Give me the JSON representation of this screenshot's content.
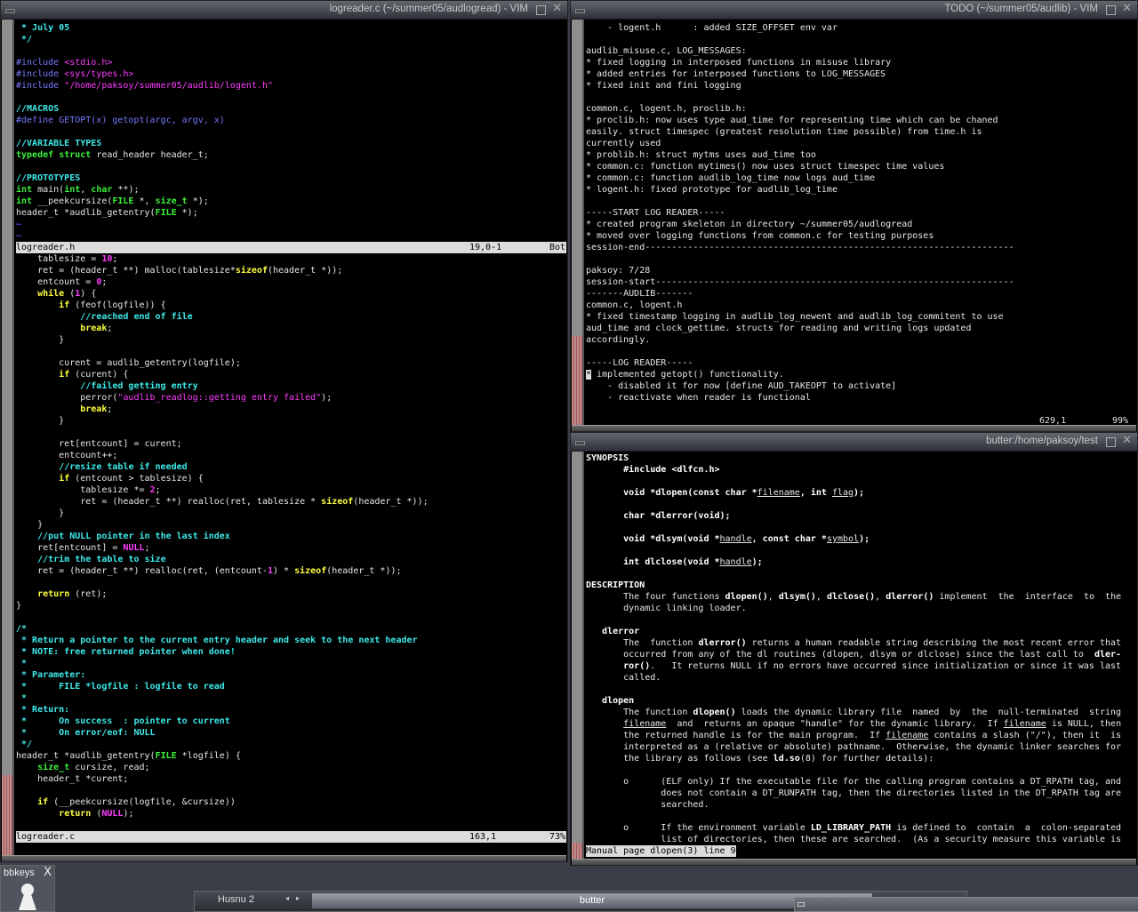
{
  "left_window": {
    "title": "logreader.c (~/summer05/audlogread) - VIM",
    "top_buffer": {
      "lines": [
        [
          [
            "c",
            " * July 05"
          ]
        ],
        [
          [
            "c",
            " */"
          ]
        ],
        [],
        [
          [
            "p",
            "#include "
          ],
          [
            "s",
            "<stdio.h>"
          ]
        ],
        [
          [
            "p",
            "#include "
          ],
          [
            "s",
            "<sys/types.h>"
          ]
        ],
        [
          [
            "p",
            "#include "
          ],
          [
            "s",
            "\"/home/paksoy/summer05/audlib/logent.h\""
          ]
        ],
        [],
        [
          [
            "c",
            "//MACROS"
          ]
        ],
        [
          [
            "p",
            "#define GETOPT(x) getopt(argc, argv, x)"
          ]
        ],
        [],
        [
          [
            "c",
            "//VARIABLE TYPES"
          ]
        ],
        [
          [
            "t",
            "typedef"
          ],
          [
            "x",
            " "
          ],
          [
            "t",
            "struct"
          ],
          [
            "x",
            " read_header header_t;"
          ]
        ],
        [],
        [
          [
            "c",
            "//PROTOTYPES"
          ]
        ],
        [
          [
            "t",
            "int"
          ],
          [
            "x",
            " main("
          ],
          [
            "t",
            "int"
          ],
          [
            "x",
            ", "
          ],
          [
            "t",
            "char"
          ],
          [
            "x",
            " **);"
          ]
        ],
        [
          [
            "t",
            "int"
          ],
          [
            "x",
            " __peekcursize("
          ],
          [
            "t",
            "FILE"
          ],
          [
            "x",
            " *, "
          ],
          [
            "t",
            "size_t"
          ],
          [
            "x",
            " *);"
          ]
        ],
        [
          [
            "x",
            "header_t *audlib_getentry("
          ],
          [
            "t",
            "FILE"
          ],
          [
            "x",
            " *);"
          ]
        ],
        [
          [
            "tl",
            "~"
          ]
        ],
        [
          [
            "tl",
            "~"
          ]
        ]
      ],
      "status": {
        "file": "logreader.h",
        "position": "19,0-1",
        "scroll": "Bot"
      }
    },
    "bottom_buffer": {
      "lines": [
        [
          [
            "x",
            "    tablesize = "
          ],
          [
            "n",
            "10"
          ],
          [
            "x",
            ";"
          ]
        ],
        [
          [
            "x",
            "    ret = (header_t **) malloc(tablesize*"
          ],
          [
            "k",
            "sizeof"
          ],
          [
            "x",
            "(header_t *));"
          ]
        ],
        [
          [
            "x",
            "    entcount = "
          ],
          [
            "n",
            "0"
          ],
          [
            "x",
            ";"
          ]
        ],
        [
          [
            "x",
            "    "
          ],
          [
            "k",
            "while"
          ],
          [
            "x",
            " ("
          ],
          [
            "n",
            "1"
          ],
          [
            "x",
            ") {"
          ]
        ],
        [
          [
            "x",
            "        "
          ],
          [
            "k",
            "if"
          ],
          [
            "x",
            " (feof(logfile)) {"
          ]
        ],
        [
          [
            "x",
            "            "
          ],
          [
            "c",
            "//reached end of file"
          ]
        ],
        [
          [
            "x",
            "            "
          ],
          [
            "k",
            "break"
          ],
          [
            "x",
            ";"
          ]
        ],
        [
          [
            "x",
            "        }"
          ]
        ],
        [],
        [
          [
            "x",
            "        curent = audlib_getentry(logfile);"
          ]
        ],
        [
          [
            "x",
            "        "
          ],
          [
            "k",
            "if"
          ],
          [
            "x",
            " (curent) {"
          ]
        ],
        [
          [
            "x",
            "            "
          ],
          [
            "c",
            "//failed getting entry"
          ]
        ],
        [
          [
            "x",
            "            perror("
          ],
          [
            "s",
            "\"audlib_readlog::getting entry failed\""
          ],
          [
            "x",
            ");"
          ]
        ],
        [
          [
            "x",
            "            "
          ],
          [
            "k",
            "break"
          ],
          [
            "x",
            ";"
          ]
        ],
        [
          [
            "x",
            "        }"
          ]
        ],
        [],
        [
          [
            "x",
            "        ret[entcount] = curent;"
          ]
        ],
        [
          [
            "x",
            "        entcount++;"
          ]
        ],
        [
          [
            "x",
            "        "
          ],
          [
            "c",
            "//resize table if needed"
          ]
        ],
        [
          [
            "x",
            "        "
          ],
          [
            "k",
            "if"
          ],
          [
            "x",
            " (entcount > tablesize) {"
          ]
        ],
        [
          [
            "x",
            "            tablesize *= "
          ],
          [
            "n",
            "2"
          ],
          [
            "x",
            ";"
          ]
        ],
        [
          [
            "x",
            "            ret = (header_t **) realloc(ret, tablesize * "
          ],
          [
            "k",
            "sizeof"
          ],
          [
            "x",
            "(header_t *));"
          ]
        ],
        [
          [
            "x",
            "        }"
          ]
        ],
        [
          [
            "x",
            "    }"
          ]
        ],
        [
          [
            "x",
            "    "
          ],
          [
            "c",
            "//put NULL pointer in the last index"
          ]
        ],
        [
          [
            "x",
            "    ret[entcount] = "
          ],
          [
            "n",
            "NULL"
          ],
          [
            "x",
            ";"
          ]
        ],
        [
          [
            "x",
            "    "
          ],
          [
            "c",
            "//trim the table to size"
          ]
        ],
        [
          [
            "x",
            "    ret = (header_t **) realloc(ret, (entcount-"
          ],
          [
            "n",
            "1"
          ],
          [
            "x",
            ") * "
          ],
          [
            "k",
            "sizeof"
          ],
          [
            "x",
            "(header_t *));"
          ]
        ],
        [],
        [
          [
            "x",
            "    "
          ],
          [
            "k",
            "return"
          ],
          [
            "x",
            " (ret);"
          ]
        ],
        [
          [
            "x",
            "}"
          ]
        ],
        [],
        [
          [
            "c",
            "/*"
          ]
        ],
        [
          [
            "c",
            " * Return a pointer to the current entry header and seek to the next header"
          ]
        ],
        [
          [
            "c",
            " * NOTE: free returned pointer when done!"
          ]
        ],
        [
          [
            "c",
            " *"
          ]
        ],
        [
          [
            "c",
            " * Parameter:"
          ]
        ],
        [
          [
            "c",
            " *      FILE *logfile : logfile to read"
          ]
        ],
        [
          [
            "c",
            " *"
          ]
        ],
        [
          [
            "c",
            " * Return:"
          ]
        ],
        [
          [
            "c",
            " *      On success  : pointer to current"
          ]
        ],
        [
          [
            "c",
            " *      On error/eof: NULL"
          ]
        ],
        [
          [
            "c",
            " */"
          ]
        ],
        [
          [
            "x",
            "header_t *audlib_getentry("
          ],
          [
            "t",
            "FILE"
          ],
          [
            "x",
            " *logfile) {"
          ]
        ],
        [
          [
            "x",
            "    "
          ],
          [
            "t",
            "size_t"
          ],
          [
            "x",
            " cursize, read;"
          ]
        ],
        [
          [
            "x",
            "    header_t *curent;"
          ]
        ],
        [],
        [
          [
            "x",
            "    "
          ],
          [
            "k",
            "if"
          ],
          [
            "x",
            " (__peekcursize(logfile, &cursize))"
          ]
        ],
        [
          [
            "x",
            "        "
          ],
          [
            "k",
            "return"
          ],
          [
            "x",
            " ("
          ],
          [
            "n",
            "NULL"
          ],
          [
            "x",
            ");"
          ]
        ],
        []
      ],
      "status": {
        "file": "logreader.c",
        "position": "163,1",
        "scroll": "73%"
      }
    }
  },
  "todo_window": {
    "title": "TODO (~/summer05/audlib) - VIM",
    "lines": [
      [
        [
          "x",
          "    - logent.h      : added SIZE_OFFSET env var"
        ]
      ],
      [],
      [
        [
          "x",
          "audlib_misuse.c, LOG_MESSAGES:"
        ]
      ],
      [
        [
          "x",
          "* fixed logging in interposed functions in misuse library"
        ]
      ],
      [
        [
          "x",
          "* added entries for interposed functions to LOG_MESSAGES"
        ]
      ],
      [
        [
          "x",
          "* fixed init and fini logging"
        ]
      ],
      [],
      [
        [
          "x",
          "common.c, logent.h, proclib.h:"
        ]
      ],
      [
        [
          "x",
          "* proclib.h: now uses type aud_time for representing time which can be chaned"
        ]
      ],
      [
        [
          "x",
          "easily. struct timespec (greatest resolution time possible) from time.h is"
        ]
      ],
      [
        [
          "x",
          "currently used"
        ]
      ],
      [
        [
          "x",
          "* problib.h: struct mytms uses aud_time too"
        ]
      ],
      [
        [
          "x",
          "* common.c: function mytimes() now uses struct timespec time values"
        ]
      ],
      [
        [
          "x",
          "* common.c: function audlib_log_time now logs aud_time"
        ]
      ],
      [
        [
          "x",
          "* logent.h: fixed prototype for audlib_log_time"
        ]
      ],
      [],
      [
        [
          "x",
          "-----START LOG READER-----"
        ]
      ],
      [
        [
          "x",
          "* created program skeleton in directory ~/summer05/audlogread"
        ]
      ],
      [
        [
          "x",
          "* moved over logging functions from common.c for testing purposes"
        ]
      ],
      [
        [
          "x",
          "session-end---------------------------------------------------------------------"
        ]
      ],
      [],
      [
        [
          "x",
          "paksoy: 7/28"
        ]
      ],
      [
        [
          "x",
          "session-start-------------------------------------------------------------------"
        ]
      ],
      [
        [
          "x",
          "-------AUDLIB-------"
        ]
      ],
      [
        [
          "x",
          "common.c, logent.h"
        ]
      ],
      [
        [
          "x",
          "* fixed timestamp logging in audlib_log_newent and audlib_log_commitent to use"
        ]
      ],
      [
        [
          "x",
          "aud_time and clock_gettime. structs for reading and writing logs updated"
        ]
      ],
      [
        [
          "x",
          "accordingly."
        ]
      ],
      [],
      [
        [
          "x",
          "-----LOG READER-----"
        ]
      ],
      [
        [
          "cur",
          "*"
        ],
        [
          "x",
          " implemented getopt() functionality."
        ]
      ],
      [
        [
          "x",
          "    - disabled it for now [define AUD_TAKEOPT to activate]"
        ]
      ],
      [
        [
          "x",
          "    - reactivate when reader is functional"
        ]
      ],
      []
    ],
    "ruler": {
      "position": "629,1",
      "scroll": "99%"
    }
  },
  "man_window": {
    "title": "butter:/home/paksoy/test",
    "lines": [
      [
        [
          "b",
          "SYNOPSIS"
        ]
      ],
      [
        [
          "b",
          "       #include <dlfcn.h>"
        ]
      ],
      [],
      [
        [
          "b",
          "       void *dlopen(const char *"
        ],
        [
          "u",
          "filename"
        ],
        [
          "b",
          ", int "
        ],
        [
          "u",
          "flag"
        ],
        [
          "b",
          ");"
        ]
      ],
      [],
      [
        [
          "b",
          "       char *dlerror(void);"
        ]
      ],
      [],
      [
        [
          "b",
          "       void *dlsym(void *"
        ],
        [
          "u",
          "handle"
        ],
        [
          "b",
          ", const char *"
        ],
        [
          "u",
          "symbol"
        ],
        [
          "b",
          ");"
        ]
      ],
      [],
      [
        [
          "b",
          "       int dlclose(void *"
        ],
        [
          "u",
          "handle"
        ],
        [
          "b",
          ");"
        ]
      ],
      [],
      [
        [
          "b",
          "DESCRIPTION"
        ]
      ],
      [
        [
          "x",
          "       The four functions "
        ],
        [
          "b",
          "dlopen()"
        ],
        [
          "x",
          ", "
        ],
        [
          "b",
          "dlsym()"
        ],
        [
          "x",
          ", "
        ],
        [
          "b",
          "dlclose()"
        ],
        [
          "x",
          ", "
        ],
        [
          "b",
          "dlerror()"
        ],
        [
          "x",
          " implement  the  interface  to  the"
        ]
      ],
      [
        [
          "x",
          "       dynamic linking loader."
        ]
      ],
      [],
      [
        [
          "b",
          "   dlerror"
        ]
      ],
      [
        [
          "x",
          "       The  function "
        ],
        [
          "b",
          "dlerror()"
        ],
        [
          "x",
          " returns a human readable string describing the most recent error that"
        ]
      ],
      [
        [
          "x",
          "       occurred from any of the dl routines (dlopen, dlsym or dlclose) since the last call to  "
        ],
        [
          "b",
          "dler-"
        ]
      ],
      [
        [
          "b",
          "       ror()"
        ],
        [
          "x",
          ".   It returns NULL if no errors have occurred since initialization or since it was last"
        ]
      ],
      [
        [
          "x",
          "       called."
        ]
      ],
      [],
      [
        [
          "b",
          "   dlopen"
        ]
      ],
      [
        [
          "x",
          "       The function "
        ],
        [
          "b",
          "dlopen()"
        ],
        [
          "x",
          " loads the dynamic library file  named  by  the  null-terminated  string"
        ]
      ],
      [
        [
          "x",
          "       "
        ],
        [
          "u",
          "filename"
        ],
        [
          "x",
          "  and  returns an opaque \"handle\" for the dynamic library.  If "
        ],
        [
          "u",
          "filename"
        ],
        [
          "x",
          " is NULL, then"
        ]
      ],
      [
        [
          "x",
          "       the returned handle is for the main program.  If "
        ],
        [
          "u",
          "filename"
        ],
        [
          "x",
          " contains a slash (\"/\"), then it  is"
        ]
      ],
      [
        [
          "x",
          "       interpreted as a (relative or absolute) pathname.  Otherwise, the dynamic linker searches for"
        ]
      ],
      [
        [
          "x",
          "       the library as follows (see "
        ],
        [
          "b",
          "ld.so"
        ],
        [
          "x",
          "(8) for further details):"
        ]
      ],
      [],
      [
        [
          "x",
          "       o      (ELF only) If the executable file for the calling program contains a DT_RPATH tag, and"
        ]
      ],
      [
        [
          "x",
          "              does not contain a DT_RUNPATH tag, then the directories listed in the DT_RPATH tag are"
        ]
      ],
      [
        [
          "x",
          "              searched."
        ]
      ],
      [],
      [
        [
          "x",
          "       o      If the environment variable "
        ],
        [
          "b",
          "LD_LIBRARY_PATH"
        ],
        [
          "x",
          " is defined to  contain  a  colon-separated"
        ]
      ],
      [
        [
          "x",
          "              list of directories, then these are searched.  (As a security measure this variable is"
        ]
      ]
    ],
    "status": "Manual page dlopen(3) line 9"
  },
  "bbkeys": {
    "label": "bbkeys",
    "close": "X"
  },
  "taskbar": {
    "workspace": "Husnu 2",
    "prev_arrow": "◂",
    "next_arrow": "▸",
    "active_task": "butter"
  },
  "colors": {
    "comment": "#3ee8e8",
    "preproc": "#7878ff",
    "string": "#ff3cff",
    "type": "#3cf03c",
    "keyword": "#ffff40",
    "desktop": "#3a3e48"
  }
}
